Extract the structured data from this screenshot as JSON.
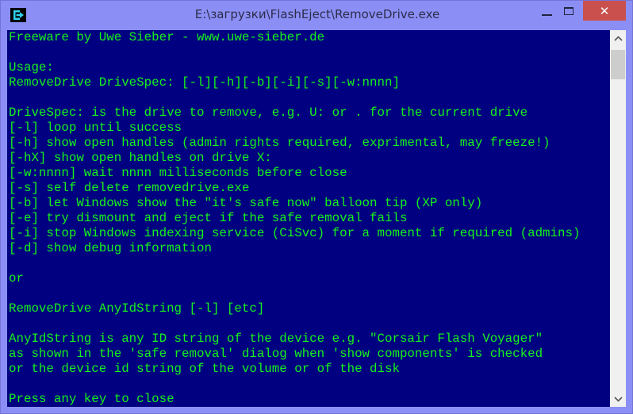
{
  "window": {
    "title": "E:\\загрузки\\FlashEject\\RemoveDrive.exe",
    "app_icon": "console-eject-icon",
    "controls": {
      "minimize_icon": "minimize-icon",
      "maximize_icon": "maximize-icon",
      "close_icon": "close-icon",
      "close_glyph": "✕",
      "close_color": "#c9504d"
    }
  },
  "console": {
    "background": "#000080",
    "foreground": "#17f21c",
    "lines": [
      "Freeware by Uwe Sieber - www.uwe-sieber.de",
      "",
      "Usage:",
      "RemoveDrive DriveSpec: [-l][-h][-b][-i][-s][-w:nnnn]",
      "",
      "DriveSpec: is the drive to remove, e.g. U: or . for the current drive",
      "[-l] loop until success",
      "[-h] show open handles (admin rights required, exprimental, may freeze!)",
      "[-hX] show open handles on drive X:",
      "[-w:nnnn] wait nnnn milliseconds before close",
      "[-s] self delete removedrive.exe",
      "[-b] let Windows show the \"it's safe now\" balloon tip (XP only)",
      "[-e] try dismount and eject if the safe removal fails",
      "[-i] stop Windows indexing service (CiSvc) for a moment if required (admins)",
      "[-d] show debug information",
      "",
      "or",
      "",
      "RemoveDrive AnyIdString [-l] [etc]",
      "",
      "AnyIdString is any ID string of the device e.g. \"Corsair Flash Voyager\"",
      "as shown in the 'safe removal' dialog when 'show components' is checked",
      "or the device id string of the volume or of the disk",
      "",
      "Press any key to close"
    ]
  },
  "scrollbar": {
    "up_glyph": "︿",
    "down_glyph": "﹀",
    "up_icon": "chevron-up-icon",
    "down_icon": "chevron-down-icon"
  }
}
